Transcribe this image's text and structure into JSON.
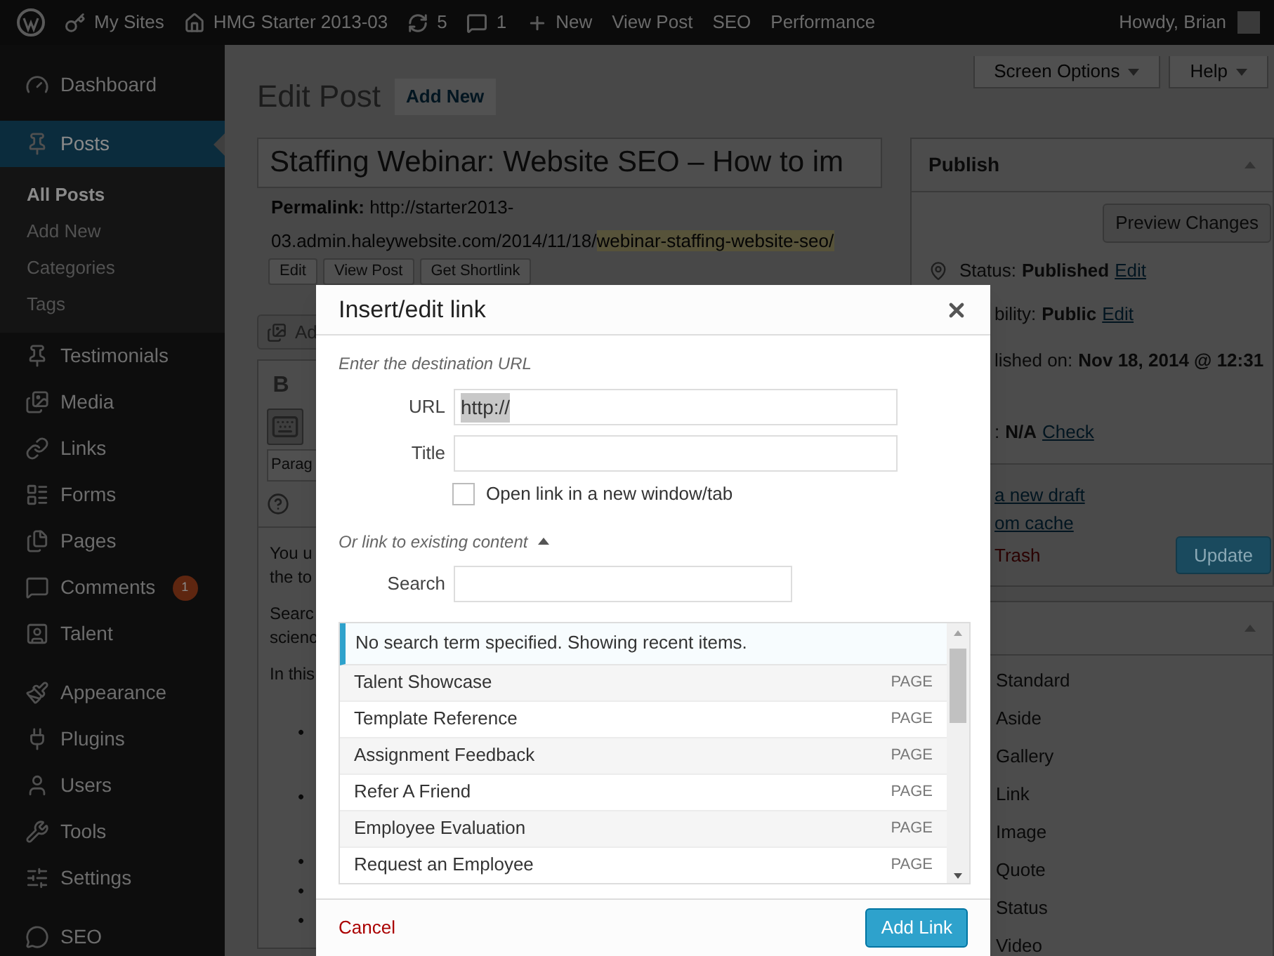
{
  "admin_bar": {
    "items": [
      {
        "kind": "sites",
        "label": "My Sites"
      },
      {
        "kind": "home",
        "label": "HMG Starter 2013-03"
      },
      {
        "kind": "updates",
        "label": "5"
      },
      {
        "kind": "comments",
        "label": "1"
      },
      {
        "kind": "new",
        "label": "New"
      },
      {
        "kind": "text",
        "label": "View Post"
      },
      {
        "kind": "text",
        "label": "SEO"
      },
      {
        "kind": "text",
        "label": "Performance"
      }
    ],
    "account": "Howdy, Brian"
  },
  "sidebar": {
    "groups": [
      {
        "items": [
          {
            "kind": "dashboard",
            "label": "Dashboard",
            "selected": false
          }
        ]
      },
      {
        "items": [
          {
            "kind": "posts",
            "label": "Posts",
            "selected": true,
            "children": [
              {
                "label": "All Posts",
                "selected": true
              },
              {
                "label": "Add New",
                "selected": false
              },
              {
                "label": "Categories",
                "selected": false
              },
              {
                "label": "Tags",
                "selected": false
              }
            ]
          },
          {
            "kind": "testimonials",
            "label": "Testimonials",
            "selected": false
          },
          {
            "kind": "media",
            "label": "Media",
            "selected": false
          },
          {
            "kind": "links",
            "label": "Links",
            "selected": false
          },
          {
            "kind": "forms",
            "label": "Forms",
            "selected": false
          },
          {
            "kind": "pages",
            "label": "Pages",
            "selected": false
          },
          {
            "kind": "comments",
            "label": "Comments",
            "selected": false,
            "badge": "1"
          },
          {
            "kind": "talent",
            "label": "Talent",
            "selected": false
          }
        ]
      },
      {
        "items": [
          {
            "kind": "appearance",
            "label": "Appearance",
            "selected": false
          },
          {
            "kind": "plugins",
            "label": "Plugins",
            "selected": false
          },
          {
            "kind": "users",
            "label": "Users",
            "selected": false
          },
          {
            "kind": "tools",
            "label": "Tools",
            "selected": false
          },
          {
            "kind": "settings",
            "label": "Settings",
            "selected": false
          }
        ]
      },
      {
        "items": [
          {
            "kind": "seo",
            "label": "SEO",
            "selected": false
          }
        ]
      }
    ]
  },
  "screen_tabs": [
    "Screen Options",
    "Help"
  ],
  "heading": "Edit Post",
  "add_new": "Add New",
  "post": {
    "title": "Staffing Webinar: Website SEO – How to im",
    "permalink": {
      "label": "Permalink:",
      "url": "http://starter2013-03.admin.haleywebsite.com/2014/11/18/",
      "slug": "webinar-staffing-website-seo/"
    },
    "buttons": [
      "Edit",
      "View Post",
      "Get Shortlink"
    ]
  },
  "editor": {
    "add_media": "Ad",
    "bold": "B",
    "format": "Parag",
    "paragraphs": [
      {
        "lines": [
          "You u",
          "the to"
        ]
      },
      {
        "lines": [
          "Searc",
          "scienc"
        ]
      },
      {
        "lines": [
          "In this"
        ]
      }
    ],
    "bullets": [
      {
        "marker": "•",
        "wrapped": true
      },
      {
        "marker": "•",
        "wrapped": true
      },
      {
        "marker": "•",
        "wrapped": false
      },
      {
        "marker": "•",
        "wrapped": false
      },
      {
        "marker": "•",
        "wrapped": false
      }
    ]
  },
  "publish": {
    "title": "Publish",
    "preview": "Preview Changes",
    "rows": [
      {
        "kind": "status",
        "label": "Status:",
        "value": "Published",
        "link": "Edit"
      },
      {
        "kind": "partial",
        "label": "bility:",
        "value": "Public",
        "link": "Edit"
      },
      {
        "kind": "partial",
        "label": "lished on:",
        "value": "Nov 18, 2014 @ 12:31"
      },
      {
        "kind": "partial",
        "label": ":",
        "value": "N/A",
        "link": "Check"
      }
    ],
    "links": [
      "a new draft",
      "om cache"
    ],
    "trash": "Trash",
    "update": "Update"
  },
  "format_box": {
    "options": [
      "Standard",
      "Aside",
      "Gallery",
      "Link",
      "Image",
      "Quote",
      "Status",
      "Video"
    ]
  },
  "modal": {
    "title": "Insert/edit link",
    "intro": "Enter the destination URL",
    "url": {
      "label": "URL",
      "value": "http://"
    },
    "link_title": {
      "label": "Title"
    },
    "new_tab": {
      "label": "Open link in a new window/tab",
      "checked": false
    },
    "existing": {
      "label": "Or link to existing content",
      "expanded": true
    },
    "search": {
      "label": "Search"
    },
    "notice": "No search term specified. Showing recent items.",
    "results": [
      {
        "title": "Talent Showcase",
        "type": "PAGE"
      },
      {
        "title": "Template Reference",
        "type": "PAGE"
      },
      {
        "title": "Assignment Feedback",
        "type": "PAGE"
      },
      {
        "title": "Refer A Friend",
        "type": "PAGE"
      },
      {
        "title": "Employee Evaluation",
        "type": "PAGE"
      },
      {
        "title": "Request an Employee",
        "type": "PAGE"
      }
    ],
    "cancel": "Cancel",
    "submit": "Add Link"
  }
}
